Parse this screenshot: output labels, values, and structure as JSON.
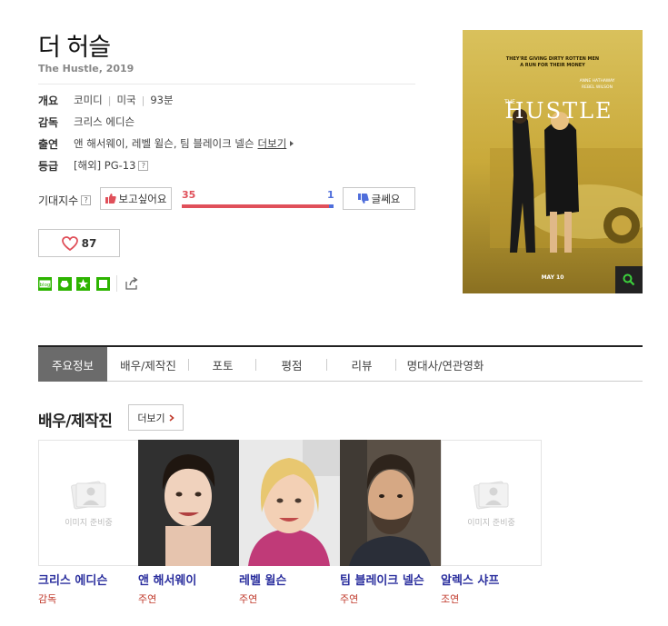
{
  "movie": {
    "title": "더 허슬",
    "subtitle": "The Hustle, 2019"
  },
  "info": {
    "overview_label": "개요",
    "genre": "코미디",
    "country": "미국",
    "runtime": "93분",
    "director_label": "감독",
    "director": "크리스 에디슨",
    "cast_label": "출연",
    "cast": "앤 해서웨이, 레벨 윌슨, 팀 블레이크 넬슨",
    "cast_more": "더보기",
    "rating_label": "등급",
    "rating": "[해외] PG-13",
    "help_mark": "?"
  },
  "expectation": {
    "label": "기대지수",
    "want_button": "보고싶어요",
    "want_count": "35",
    "not_count": "1",
    "not_button": "글쎄요",
    "want_ratio": 0.97
  },
  "like": {
    "count": "87"
  },
  "social": {
    "icons": [
      "blog-icon",
      "cafe-icon",
      "bookmark-star-icon",
      "memo-icon",
      "share-icon"
    ],
    "blog_text": "blog"
  },
  "poster": {
    "tagline1": "THEY'RE GIVING DIRTY ROTTEN MEN",
    "tagline2": "A RUN FOR THEIR MONEY",
    "stars1": "ANNE HATHAWAY",
    "stars2": "REBEL WILSON",
    "the": "THE",
    "title": "HUSTLE",
    "date": "MAY 10"
  },
  "tabs": [
    {
      "label": "주요정보",
      "active": true
    },
    {
      "label": "배우/제작진"
    },
    {
      "label": "포토"
    },
    {
      "label": "평점"
    },
    {
      "label": "리뷰"
    },
    {
      "label": "명대사/연관영화"
    }
  ],
  "cast_section": {
    "title": "배우/제작진",
    "more_button": "더보기",
    "no_image_text": "이미지 준비중",
    "members": [
      {
        "name": "크리스 에디슨",
        "role": "감독"
      },
      {
        "name": "앤 해서웨이",
        "role": "주연"
      },
      {
        "name": "레벨 윌슨",
        "role": "주연"
      },
      {
        "name": "팀 블레이크 넬슨",
        "role": "주연"
      },
      {
        "name": "알렉스 샤프",
        "role": "조연"
      }
    ]
  },
  "colors": {
    "want_bar": "#e0505a",
    "not_bar": "#4f6edb",
    "cast_name": "#2b2f9e",
    "cast_role": "#c0392b",
    "social_green": "#2db400"
  }
}
